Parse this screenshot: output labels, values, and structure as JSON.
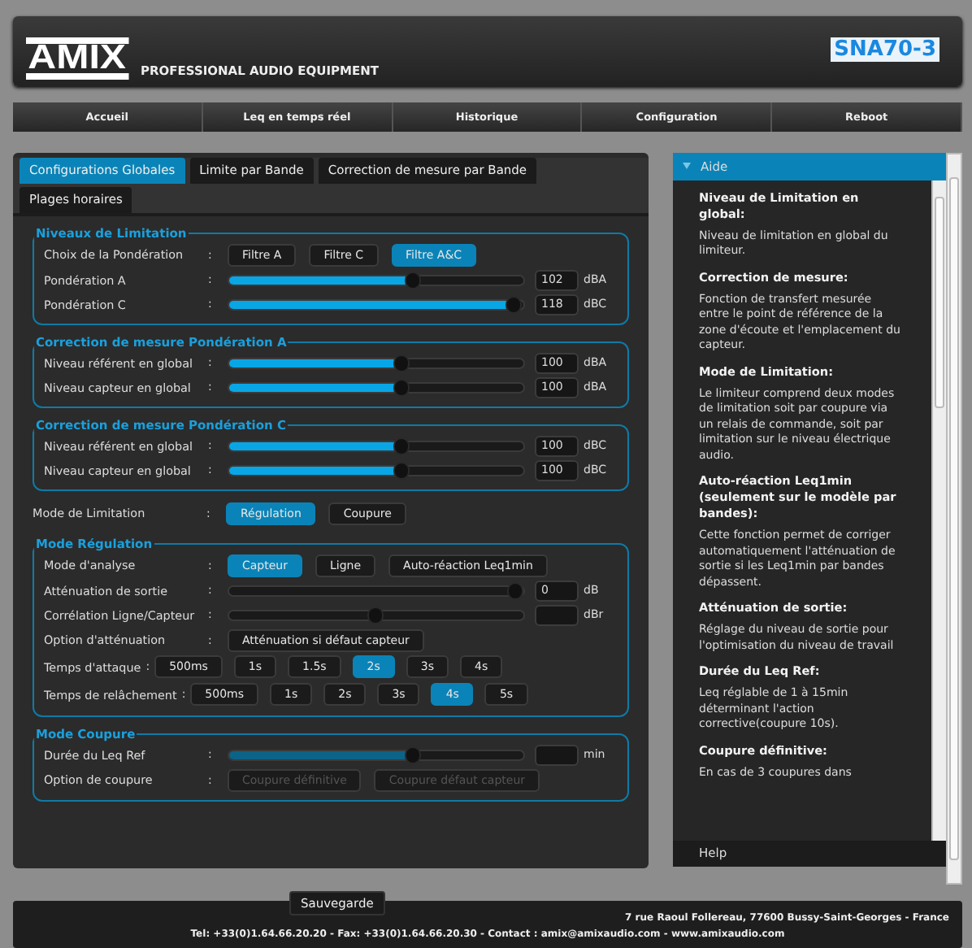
{
  "header": {
    "logo": "AMIX",
    "tagline": "PROFESSIONAL AUDIO EQUIPMENT",
    "model": "SNA70-3"
  },
  "nav": [
    "Accueil",
    "Leq en temps réel",
    "Historique",
    "Configuration",
    "Reboot"
  ],
  "tabs": [
    {
      "label": "Configurations Globales",
      "selected": true
    },
    {
      "label": "Limite par Bande",
      "selected": false
    },
    {
      "label": "Correction de mesure par Bande",
      "selected": false
    },
    {
      "label": "Plages horaires",
      "selected": false
    }
  ],
  "blocks": [
    {
      "kind": "fieldset",
      "legend": "Niveaux de Limitation",
      "rows": [
        {
          "kind": "choice",
          "sep": ":",
          "label": "Choix de la Pondération",
          "options": [
            {
              "label": "Filtre A",
              "selected": false
            },
            {
              "label": "Filtre C",
              "selected": false
            },
            {
              "label": "Filtre A&C",
              "selected": true
            }
          ]
        },
        {
          "kind": "slider",
          "sep": ":",
          "label": "Pondération A",
          "level": 0.63,
          "value": "102",
          "unit": "dBA"
        },
        {
          "kind": "slider",
          "sep": ":",
          "label": "Pondération C",
          "level": 0.97,
          "value": "118",
          "unit": "dBC"
        }
      ]
    },
    {
      "kind": "fieldset",
      "legend": "Correction de mesure Pondération A",
      "rows": [
        {
          "kind": "slider",
          "sep": ":",
          "label": "Niveau référent en global",
          "level": 0.59,
          "value": "100",
          "unit": "dBA"
        },
        {
          "kind": "slider",
          "sep": ":",
          "label": "Niveau capteur en global",
          "level": 0.59,
          "value": "100",
          "unit": "dBA"
        }
      ]
    },
    {
      "kind": "fieldset",
      "legend": "Correction de mesure Pondération C",
      "rows": [
        {
          "kind": "slider",
          "sep": ":",
          "label": "Niveau référent en global",
          "level": 0.59,
          "value": "100",
          "unit": "dBC"
        },
        {
          "kind": "slider",
          "sep": ":",
          "label": "Niveau capteur en global",
          "level": 0.59,
          "value": "100",
          "unit": "dBC"
        }
      ]
    },
    {
      "kind": "row",
      "row": {
        "kind": "choice",
        "sep": ":",
        "label": "Mode de Limitation",
        "options": [
          {
            "label": "Régulation",
            "selected": true
          },
          {
            "label": "Coupure",
            "selected": false
          }
        ]
      }
    },
    {
      "kind": "fieldset",
      "legend": "Mode Régulation",
      "rows": [
        {
          "kind": "choice",
          "sep": ":",
          "label": "Mode d'analyse",
          "options": [
            {
              "label": "Capteur",
              "selected": true
            },
            {
              "label": "Ligne",
              "selected": false
            },
            {
              "label": "Auto-réaction Leq1min",
              "selected": false
            }
          ]
        },
        {
          "kind": "slider-thumb",
          "sep": ":",
          "label": "Atténuation de sortie",
          "level": 0.98,
          "value": "0",
          "unit": "dB"
        },
        {
          "kind": "slider-thumb",
          "sep": ":",
          "label": "Corrélation Ligne/Capteur",
          "level": 0.5,
          "unit": "dBr"
        },
        {
          "kind": "choice",
          "sep": ":",
          "label": "Option d'atténuation",
          "options": [
            {
              "label": "Atténuation si défaut capteur",
              "selected": false
            }
          ]
        },
        {
          "kind": "times",
          "sep": ":",
          "label": "Temps d'attaque",
          "options": [
            {
              "label": "500ms",
              "selected": false
            },
            {
              "label": "1s",
              "selected": false
            },
            {
              "label": "1.5s",
              "selected": false
            },
            {
              "label": "2s",
              "selected": true
            },
            {
              "label": "3s",
              "selected": false
            },
            {
              "label": "4s",
              "selected": false
            }
          ]
        },
        {
          "kind": "times",
          "sep": ":",
          "label": "Temps de relâchement",
          "options": [
            {
              "label": "500ms",
              "selected": false
            },
            {
              "label": "1s",
              "selected": false
            },
            {
              "label": "2s",
              "selected": false
            },
            {
              "label": "3s",
              "selected": false
            },
            {
              "label": "4s",
              "selected": true
            },
            {
              "label": "5s",
              "selected": false
            }
          ]
        }
      ]
    },
    {
      "kind": "fieldset",
      "legend": "Mode Coupure",
      "rows": [
        {
          "kind": "slider-dim",
          "sep": ":",
          "label": "Durée du Leq Ref",
          "level": 0.63,
          "unit": "min"
        },
        {
          "kind": "choice",
          "sep": ":",
          "label": "Option de coupure",
          "disabled": true,
          "options": [
            {
              "label": "Coupure définitive",
              "selected": false
            },
            {
              "label": "Coupure défaut capteur",
              "selected": false
            }
          ]
        }
      ]
    }
  ],
  "help": {
    "title": "Aide",
    "footer": "Help",
    "items": [
      {
        "kind": "heading",
        "text": "Niveau de Limitation en global:"
      },
      {
        "kind": "text",
        "text": "Niveau de limitation en global du limiteur."
      },
      {
        "kind": "heading",
        "text": "Correction de mesure:"
      },
      {
        "kind": "text",
        "text": "Fonction de transfert mesurée entre le point de référence de la zone d'écoute et l'emplacement du capteur."
      },
      {
        "kind": "heading",
        "text": "Mode de Limitation:"
      },
      {
        "kind": "text",
        "text": "Le limiteur comprend deux modes de limitation soit par coupure via un relais de commande, soit par limitation sur le niveau électrique audio."
      },
      {
        "kind": "heading",
        "text": "Auto-réaction Leq1min (seulement sur le modèle par bandes):"
      },
      {
        "kind": "text",
        "text": "Cette fonction permet de corriger automatiquement l'atténuation de sortie si les Leq1min par bandes dépassent."
      },
      {
        "kind": "heading",
        "text": "Atténuation de sortie:"
      },
      {
        "kind": "text",
        "text": "Réglage du niveau de sortie pour l'optimisation du niveau de travail"
      },
      {
        "kind": "heading",
        "text": "Durée du Leq Ref:"
      },
      {
        "kind": "text",
        "text": "Leq réglable de 1 à 15min déterminant l'action corrective(coupure 10s)."
      },
      {
        "kind": "heading",
        "text": "Coupure définitive:"
      },
      {
        "kind": "text",
        "text": "En cas de 3 coupures dans"
      }
    ]
  },
  "save": "Sauvegarde",
  "footer": [
    "7 rue Raoul Follereau, 77600 Bussy-Saint-Georges - France",
    "Tel: +33(0)1.64.66.20.20 - Fax: +33(0)1.64.66.20.30 - Contact : amix@amixaudio.com - www.amixaudio.com"
  ]
}
